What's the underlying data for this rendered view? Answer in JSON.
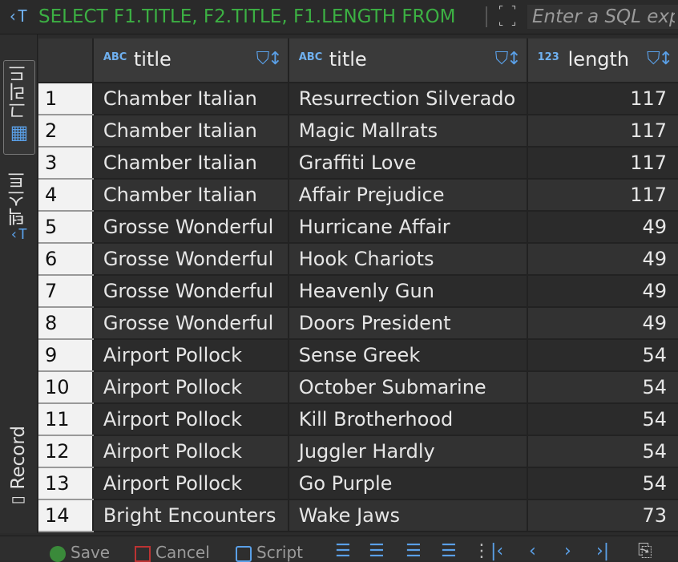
{
  "filter": {
    "query": "SELECT F1.TITLE, F2.TITLE, F1.LENGTH FROM",
    "placeholder": "Enter a SQL expression to filter results"
  },
  "left_tabs": [
    {
      "label": "그리드",
      "icon": "grid-icon",
      "active": true
    },
    {
      "label": "텍스트",
      "icon": "text-icon",
      "active": false
    },
    {
      "label": "Record",
      "icon": "record-icon",
      "active": false
    }
  ],
  "columns": [
    {
      "type": "ABC",
      "name": "title"
    },
    {
      "type": "ABC",
      "name": "title"
    },
    {
      "type": "123",
      "name": "length"
    }
  ],
  "rows": [
    {
      "n": "1",
      "c1": "Chamber Italian",
      "c2": "Resurrection Silverado",
      "c3": "117"
    },
    {
      "n": "2",
      "c1": "Chamber Italian",
      "c2": "Magic Mallrats",
      "c3": "117"
    },
    {
      "n": "3",
      "c1": "Chamber Italian",
      "c2": "Graffiti Love",
      "c3": "117"
    },
    {
      "n": "4",
      "c1": "Chamber Italian",
      "c2": "Affair Prejudice",
      "c3": "117"
    },
    {
      "n": "5",
      "c1": "Grosse Wonderful",
      "c2": "Hurricane Affair",
      "c3": "49"
    },
    {
      "n": "6",
      "c1": "Grosse Wonderful",
      "c2": "Hook Chariots",
      "c3": "49"
    },
    {
      "n": "7",
      "c1": "Grosse Wonderful",
      "c2": "Heavenly Gun",
      "c3": "49"
    },
    {
      "n": "8",
      "c1": "Grosse Wonderful",
      "c2": "Doors President",
      "c3": "49"
    },
    {
      "n": "9",
      "c1": "Airport Pollock",
      "c2": "Sense Greek",
      "c3": "54"
    },
    {
      "n": "10",
      "c1": "Airport Pollock",
      "c2": "October Submarine",
      "c3": "54"
    },
    {
      "n": "11",
      "c1": "Airport Pollock",
      "c2": "Kill Brotherhood",
      "c3": "54"
    },
    {
      "n": "12",
      "c1": "Airport Pollock",
      "c2": "Juggler Hardly",
      "c3": "54"
    },
    {
      "n": "13",
      "c1": "Airport Pollock",
      "c2": "Go Purple",
      "c3": "54"
    },
    {
      "n": "14",
      "c1": "Bright Encounters",
      "c2": "Wake Jaws",
      "c3": "73"
    }
  ],
  "toolbar": {
    "save_label": "Save",
    "cancel_label": "Cancel",
    "script_label": "Script"
  },
  "colors": {
    "background": "#2b2b2b",
    "query_text": "#3cb043",
    "accent": "#5aa0e8",
    "rownum_bg": "#f2f2f2"
  }
}
